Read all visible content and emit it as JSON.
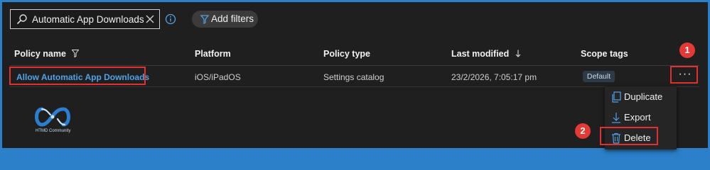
{
  "search": {
    "value": "Automatic App Downloads",
    "icon": "search-icon",
    "clear_icon": "close-icon"
  },
  "info_icon": "info-icon",
  "filters": {
    "label": "Add filters",
    "icon": "filter-icon"
  },
  "table": {
    "columns": {
      "policy_name": "Policy name",
      "platform": "Platform",
      "policy_type": "Policy type",
      "last_modified": "Last modified",
      "scope_tags": "Scope tags"
    },
    "rows": [
      {
        "name": "Allow Automatic App Downloads",
        "platform": "iOS/iPadOS",
        "type": "Settings catalog",
        "modified": "23/2/2026, 7:05:17 pm",
        "scope": "Default",
        "more": "···"
      }
    ]
  },
  "context_menu": {
    "items": [
      {
        "label": "Duplicate",
        "icon": "duplicate-icon"
      },
      {
        "label": "Export",
        "icon": "export-icon"
      },
      {
        "label": "Delete",
        "icon": "trash-icon"
      }
    ]
  },
  "annotations": {
    "step1": "1",
    "step2": "2"
  },
  "logo": {
    "text": "HTMD Community"
  },
  "colors": {
    "accent_link": "#4ea3e8",
    "highlight": "#e03030",
    "step_badge": "#e53935",
    "frame": "#2b80c9"
  }
}
